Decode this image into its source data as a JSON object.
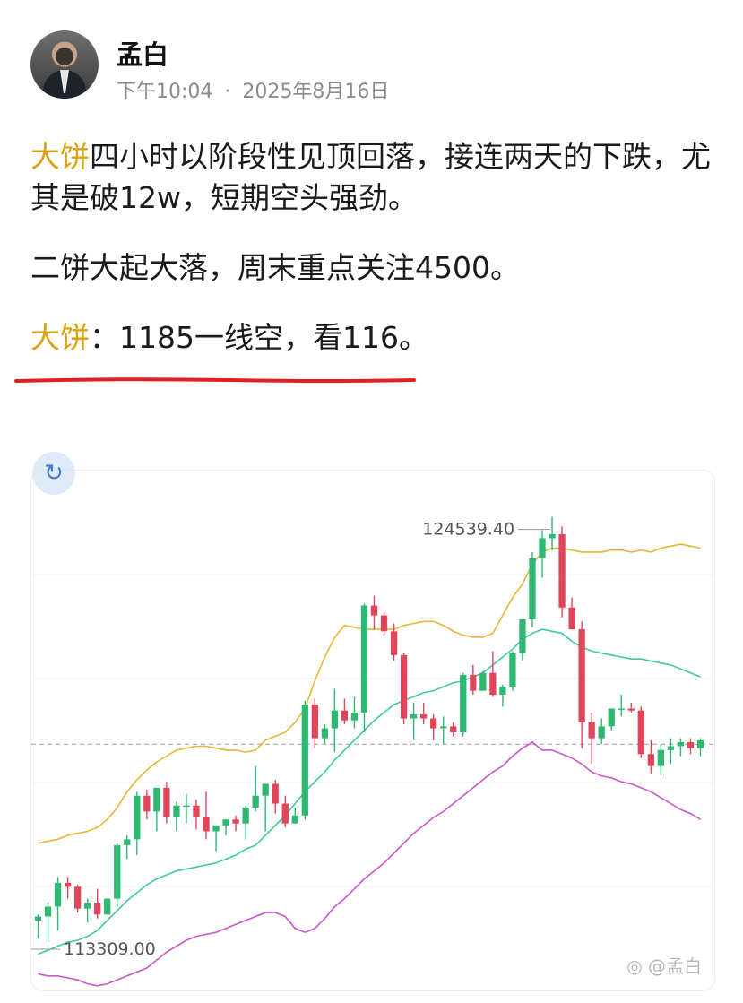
{
  "author": {
    "name": "孟白",
    "time": "下午10:04",
    "separator": "·",
    "date": "2025年8月16日"
  },
  "post": {
    "p1_highlight": "大饼",
    "p1_text": "四小时以阶段性见顶回落，接连两天的下跌，尤其是破12w，短期空头强劲。",
    "p2_text": "二饼大起大落，周末重点关注4500。",
    "p3_highlight": "大饼",
    "p3_text": "：1185一线空，看116。",
    "underline_color": "#e02020",
    "highlight_color": "#d9a20f"
  },
  "chart_data": {
    "type": "candlestick",
    "title": "",
    "annotations": {
      "high_label": "124539.40",
      "low_label": "113309.00"
    },
    "ylim": [
      112900,
      125300
    ],
    "current_price_line": 118800,
    "colors": {
      "up": "#2eb872",
      "down": "#e0455a",
      "upper_band": "#e8b534",
      "middle_band": "#3ec9a4",
      "lower_band": "#cc55c8",
      "current_line": "#9a9a9a"
    },
    "candles": [
      [
        114350,
        114500,
        113900,
        114450
      ],
      [
        114450,
        114800,
        113800,
        114700
      ],
      [
        114700,
        115450,
        114100,
        115300
      ],
      [
        115300,
        115450,
        114900,
        115200
      ],
      [
        115200,
        115250,
        114550,
        114650
      ],
      [
        114650,
        114900,
        114300,
        114800
      ],
      [
        114800,
        115150,
        114400,
        114500
      ],
      [
        114500,
        114900,
        114500,
        114900
      ],
      [
        114900,
        116300,
        114700,
        116250
      ],
      [
        116250,
        116500,
        115900,
        116400
      ],
      [
        116400,
        117600,
        116000,
        117500
      ],
      [
        117500,
        117650,
        116900,
        117100
      ],
      [
        117100,
        117600,
        116600,
        117700
      ],
      [
        117700,
        117850,
        116800,
        116950
      ],
      [
        116950,
        117350,
        116600,
        117250
      ],
      [
        117250,
        117550,
        116800,
        117250
      ],
      [
        117250,
        117400,
        116650,
        116950
      ],
      [
        116950,
        117600,
        116400,
        116600
      ],
      [
        116600,
        116750,
        116100,
        116750
      ],
      [
        116750,
        116900,
        116500,
        116900
      ],
      [
        116900,
        117000,
        116600,
        116800
      ],
      [
        116800,
        117250,
        116400,
        117200
      ],
      [
        117200,
        118250,
        117100,
        117500
      ],
      [
        117500,
        117650,
        116600,
        117800
      ],
      [
        117800,
        117900,
        117050,
        117300
      ],
      [
        117300,
        117500,
        116700,
        116800
      ],
      [
        116800,
        117200,
        116800,
        117000
      ],
      [
        117000,
        119900,
        116900,
        119800
      ],
      [
        119800,
        119950,
        118700,
        118950
      ],
      [
        118950,
        119300,
        118800,
        119200
      ],
      [
        119200,
        120200,
        118600,
        119650
      ],
      [
        119650,
        119950,
        119300,
        119400
      ],
      [
        119400,
        120000,
        119200,
        119600
      ],
      [
        119600,
        122350,
        119100,
        122300
      ],
      [
        122300,
        122550,
        121700,
        122050
      ],
      [
        122050,
        122150,
        121550,
        121650
      ],
      [
        121650,
        121850,
        120900,
        121050
      ],
      [
        121050,
        121100,
        119300,
        119450
      ],
      [
        119450,
        119850,
        118900,
        119550
      ],
      [
        119550,
        119850,
        119300,
        119450
      ],
      [
        119450,
        119550,
        118900,
        119200
      ],
      [
        119200,
        119500,
        118800,
        119250
      ],
      [
        119250,
        119350,
        119000,
        119100
      ],
      [
        119100,
        120600,
        119000,
        120550
      ],
      [
        120550,
        120800,
        120050,
        120150
      ],
      [
        120150,
        120650,
        120150,
        120600
      ],
      [
        120600,
        121150,
        120000,
        120050
      ],
      [
        120050,
        120300,
        119750,
        120250
      ],
      [
        120250,
        121150,
        120150,
        121100
      ],
      [
        121100,
        121950,
        120900,
        121950
      ],
      [
        121950,
        123650,
        121750,
        123500
      ],
      [
        123500,
        124200,
        123000,
        124000
      ],
      [
        124000,
        124539,
        123700,
        124100
      ],
      [
        124100,
        124300,
        122000,
        122250
      ],
      [
        122250,
        122500,
        121800,
        121700
      ],
      [
        121700,
        121900,
        118700,
        119350
      ],
      [
        119350,
        119600,
        118300,
        118950
      ],
      [
        118950,
        119450,
        118800,
        119250
      ],
      [
        119250,
        119550,
        119150,
        119700
      ],
      [
        119700,
        120050,
        119500,
        119700
      ],
      [
        119700,
        119850,
        119600,
        119650
      ],
      [
        119650,
        119750,
        118450,
        118550
      ],
      [
        118550,
        118900,
        118050,
        118250
      ],
      [
        118250,
        118800,
        118000,
        118650
      ],
      [
        118650,
        118950,
        118300,
        118750
      ],
      [
        118750,
        118950,
        118500,
        118850
      ],
      [
        118850,
        118950,
        118550,
        118700
      ],
      [
        118700,
        118950,
        118500,
        118900
      ]
    ],
    "upper_band": [
      116300,
      116350,
      116400,
      116500,
      116550,
      116600,
      116700,
      116900,
      117200,
      117600,
      117900,
      118150,
      118350,
      118500,
      118650,
      118700,
      118750,
      118750,
      118700,
      118650,
      118650,
      118600,
      118650,
      118900,
      119000,
      119100,
      119350,
      119700,
      120400,
      121000,
      121500,
      121800,
      121750,
      121700,
      121700,
      121700,
      121700,
      121800,
      121850,
      121900,
      121900,
      121800,
      121650,
      121550,
      121500,
      121500,
      121600,
      122050,
      122500,
      122850,
      123350,
      123650,
      123750,
      123750,
      123700,
      123650,
      123650,
      123650,
      123700,
      123700,
      123650,
      123700,
      123650,
      123750,
      123800,
      123850,
      123800,
      123750
    ],
    "middle_band": [
      113500,
      113600,
      113700,
      113800,
      113850,
      113950,
      114100,
      114350,
      114600,
      114850,
      115050,
      115250,
      115400,
      115500,
      115600,
      115650,
      115700,
      115750,
      115800,
      115900,
      116000,
      116150,
      116250,
      116500,
      116750,
      117000,
      117300,
      117600,
      117850,
      118100,
      118400,
      118650,
      118900,
      119150,
      119400,
      119600,
      119800,
      119900,
      120000,
      120100,
      120150,
      120250,
      120350,
      120400,
      120500,
      120600,
      120800,
      121000,
      121200,
      121450,
      121600,
      121700,
      121650,
      121600,
      121400,
      121250,
      121150,
      121100,
      121050,
      121000,
      120950,
      120950,
      120900,
      120850,
      120800,
      120700,
      120600,
      120500
    ],
    "lower_band": [
      113000,
      112950,
      112950,
      112900,
      112850,
      112750,
      112700,
      112750,
      112850,
      112950,
      113050,
      113150,
      113350,
      113550,
      113700,
      113850,
      113950,
      114000,
      114050,
      114150,
      114250,
      114350,
      114450,
      114550,
      114550,
      114450,
      114150,
      114050,
      114150,
      114400,
      114700,
      114900,
      115150,
      115400,
      115600,
      115800,
      116050,
      116300,
      116550,
      116750,
      116950,
      117100,
      117300,
      117500,
      117700,
      117900,
      118100,
      118250,
      118500,
      118700,
      118850,
      118650,
      118650,
      118550,
      118450,
      118300,
      118100,
      118000,
      117950,
      117850,
      117800,
      117700,
      117600,
      117450,
      117300,
      117150,
      117050,
      116900
    ]
  },
  "watermark": {
    "text": "孟白",
    "icon": "brand-logo-icon"
  },
  "refresh": {
    "icon": "refresh-icon",
    "glyph": "↻"
  }
}
